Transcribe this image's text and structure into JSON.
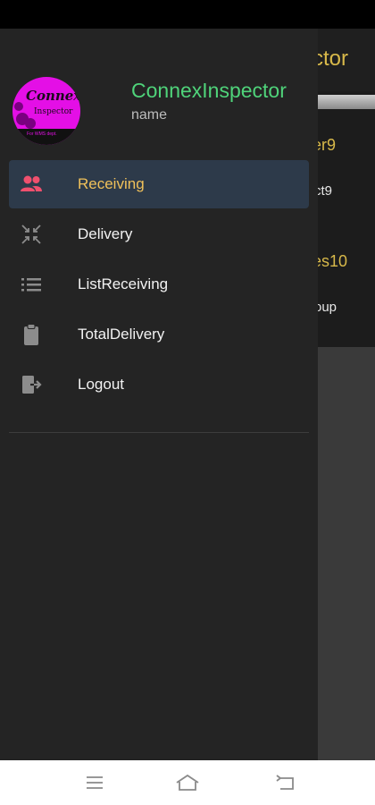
{
  "background_app": {
    "title_fragment": "ctor",
    "item1_title_fragment": "er9",
    "item1_sub_fragment": "ct9",
    "item2_title_fragment": "es10",
    "item2_sub_fragment": "oup"
  },
  "drawer": {
    "app_name": "ConnexInspector",
    "user_name": "name",
    "logo": {
      "text_main": "Connex",
      "text_sub": "Inspector",
      "tagline": "For WMS dept."
    },
    "items": [
      {
        "label": "Receiving",
        "icon": "people-icon",
        "active": true
      },
      {
        "label": "Delivery",
        "icon": "compress-arrows-icon",
        "active": false
      },
      {
        "label": "ListReceiving",
        "icon": "list-icon",
        "active": false
      },
      {
        "label": "TotalDelivery",
        "icon": "clipboard-icon",
        "active": false
      },
      {
        "label": "Logout",
        "icon": "logout-icon",
        "active": false
      }
    ]
  },
  "colors": {
    "accent_gold": "#f0c15a",
    "app_name_green": "#4fd37a",
    "active_icon": "#f0506e",
    "drawer_bg": "#242424"
  }
}
